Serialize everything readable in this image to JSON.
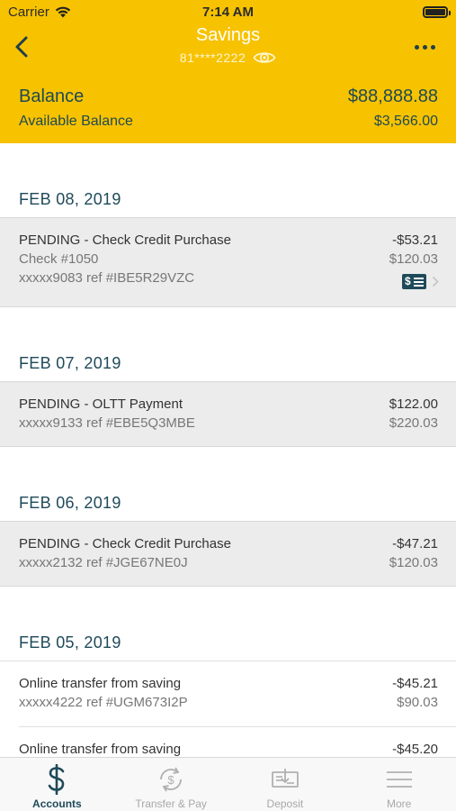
{
  "status_bar": {
    "carrier": "Carrier",
    "time": "7:14 AM"
  },
  "nav": {
    "title": "Savings",
    "account_masked": "81****2222"
  },
  "balance": {
    "label": "Balance",
    "value": "$88,888.88",
    "available_label": "Available Balance",
    "available_value": "$3,566.00"
  },
  "groups": [
    {
      "date": "FEB 08, 2019",
      "transactions": [
        {
          "desc": "PENDING - Check Credit Purchase",
          "amount": "-$53.21",
          "line2": "Check #1050",
          "line2_amount": "$120.03",
          "line3": "xxxxx9083 ref #IBE5R29VZC",
          "has_check_image": true
        }
      ]
    },
    {
      "date": "FEB 07, 2019",
      "transactions": [
        {
          "desc": "PENDING - OLTT Payment",
          "amount": "$122.00",
          "line2": "xxxxx9133 ref #EBE5Q3MBE",
          "line2_amount": "$220.03"
        }
      ]
    },
    {
      "date": "FEB 06, 2019",
      "transactions": [
        {
          "desc": "PENDING - Check Credit Purchase",
          "amount": "-$47.21",
          "line2": "xxxxx2132 ref #JGE67NE0J",
          "line2_amount": "$120.03"
        }
      ]
    },
    {
      "date": "FEB 05, 2019",
      "transactions": [
        {
          "desc": "Online transfer from saving",
          "amount": "-$45.21",
          "line2": "xxxxx4222 ref #UGM673I2P",
          "line2_amount": "$90.03"
        },
        {
          "desc": "Online transfer from saving",
          "amount": "-$45.20"
        }
      ]
    }
  ],
  "tabs": [
    {
      "label": "Accounts",
      "icon": "dollar-icon",
      "active": true
    },
    {
      "label": "Transfer & Pay",
      "icon": "transfer-icon",
      "active": false
    },
    {
      "label": "Deposit",
      "icon": "deposit-check-icon",
      "active": false
    },
    {
      "label": "More",
      "icon": "hamburger-menu-icon",
      "active": false
    }
  ],
  "colors": {
    "header": "#f7c200",
    "accent": "#1f4a5a",
    "pending_row": "#ececec"
  }
}
